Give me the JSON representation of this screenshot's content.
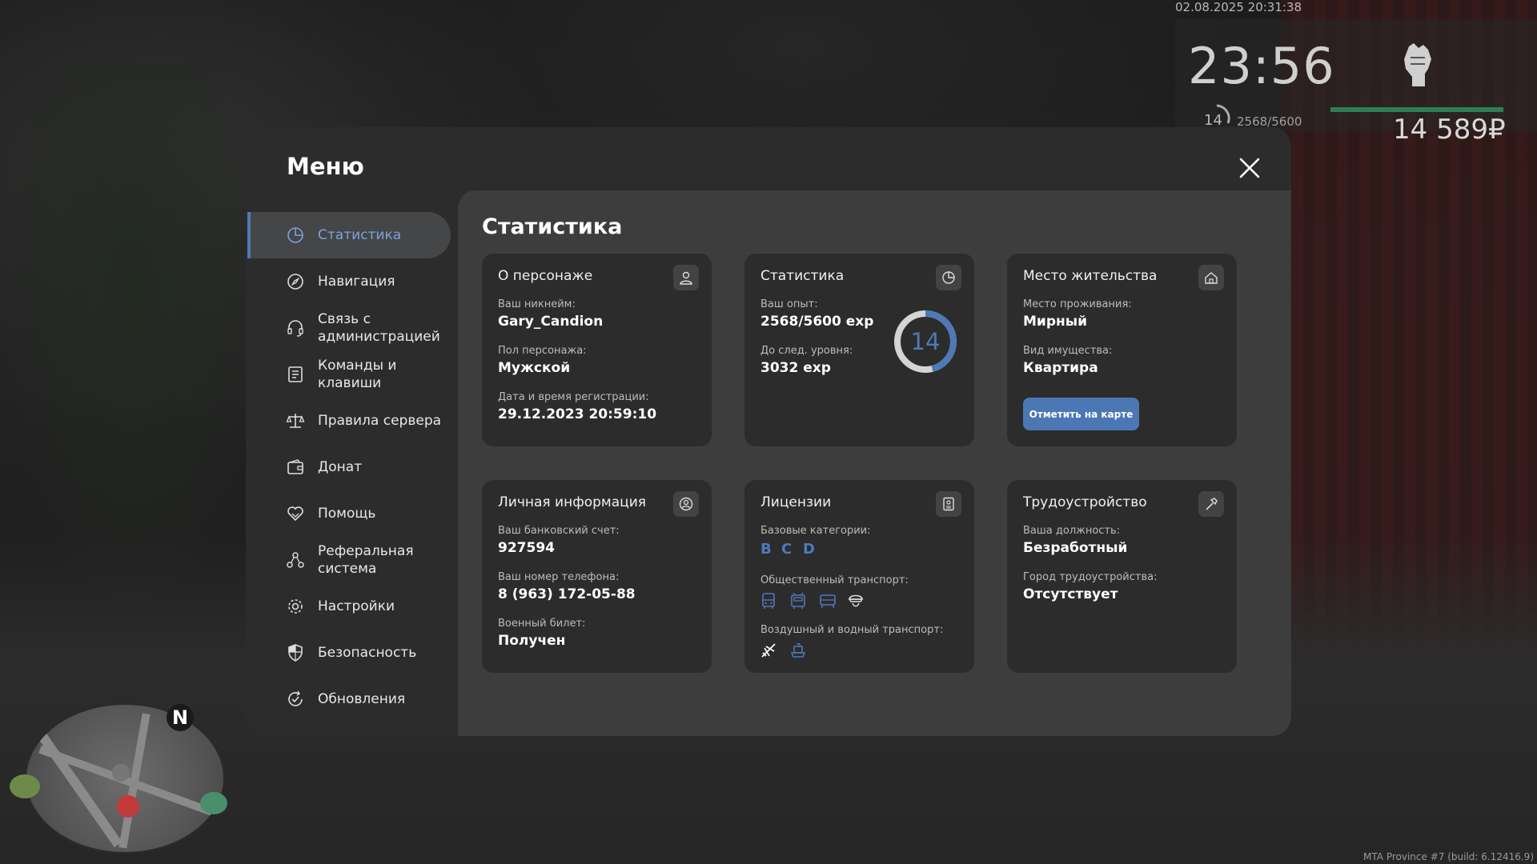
{
  "hud": {
    "datetime": "02.08.2025 20:31:38",
    "time": "23:56",
    "level": "14",
    "exp": "2568/5600",
    "money": "14 589₽"
  },
  "build": "MTA Province #7 (build: 6.12416.9)",
  "minimap": {
    "north": "N"
  },
  "menu": {
    "title": "Меню",
    "sidebar": [
      {
        "label": "Статистика",
        "icon": "pie-chart-icon",
        "active": true
      },
      {
        "label": "Навигация",
        "icon": "compass-icon"
      },
      {
        "label": "Связь с администрацией",
        "icon": "headset-icon"
      },
      {
        "label": "Команды и клавиши",
        "icon": "document-list-icon"
      },
      {
        "label": "Правила сервера",
        "icon": "scales-icon"
      },
      {
        "label": "Донат",
        "icon": "wallet-icon"
      },
      {
        "label": "Помощь",
        "icon": "heart-hands-icon"
      },
      {
        "label": "Реферальная система",
        "icon": "people-network-icon"
      },
      {
        "label": "Настройки",
        "icon": "gear-icon"
      },
      {
        "label": "Безопасность",
        "icon": "shield-icon"
      },
      {
        "label": "Обновления",
        "icon": "refresh-check-icon"
      }
    ]
  },
  "content": {
    "title": "Статистика",
    "character": {
      "title": "О персонаже",
      "nick_label": "Ваш никнейм:",
      "nick": "Gary_Candion",
      "gender_label": "Пол персонажа:",
      "gender": "Мужской",
      "reg_label": "Дата и время регистрации:",
      "reg": "29.12.2023 20:59:10"
    },
    "stats": {
      "title": "Статистика",
      "exp_label": "Ваш опыт:",
      "exp": "2568/5600 exp",
      "next_label": "До след. уровня:",
      "next": "3032 exp",
      "level": "14",
      "progress": 0.46
    },
    "residence": {
      "title": "Место жительства",
      "place_label": "Место проживания:",
      "place": "Мирный",
      "property_label": "Вид имущества:",
      "property": "Квартира",
      "button": "Отметить на карте"
    },
    "personal": {
      "title": "Личная информация",
      "bank_label": "Ваш банковский счет:",
      "bank": "927594",
      "phone_label": "Ваш номер телефона:",
      "phone": "8 (963) 172-05-88",
      "military_label": "Военный билет:",
      "military": "Получен"
    },
    "licenses": {
      "title": "Лицензии",
      "basic_label": "Базовые категории:",
      "categories": [
        "B",
        "C",
        "D"
      ],
      "public_label": "Общественный транспорт:",
      "air_label": "Воздушный и водный транспорт:"
    },
    "employment": {
      "title": "Трудоустройство",
      "position_label": "Ваша должность:",
      "position": "Безработный",
      "city_label": "Город трудоустройства:",
      "city": "Отсутствует"
    }
  }
}
